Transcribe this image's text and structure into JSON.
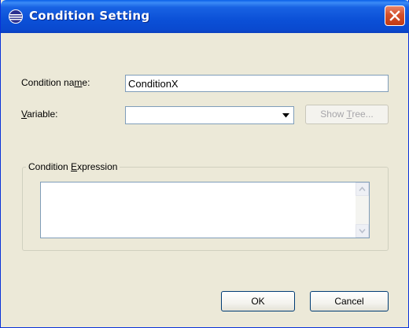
{
  "window": {
    "title": "Condition Setting"
  },
  "form": {
    "name_label_pre": "Condition na",
    "name_label_key": "m",
    "name_label_post": "e:",
    "name_value": "ConditionX",
    "variable_label_key": "V",
    "variable_label_post": "ariable:",
    "variable_value": "",
    "show_tree_pre": "Show ",
    "show_tree_key": "T",
    "show_tree_post": "ree..."
  },
  "expression_group": {
    "legend_pre": "Condition ",
    "legend_key": "E",
    "legend_post": "xpression",
    "value": ""
  },
  "footer": {
    "ok_label": "OK",
    "cancel_label": "Cancel"
  },
  "icons": {
    "title": "app-icon",
    "close": "close-icon",
    "dropdown": "chevron-down-icon",
    "scroll_up": "scroll-up-icon",
    "scroll_down": "scroll-down-icon"
  }
}
